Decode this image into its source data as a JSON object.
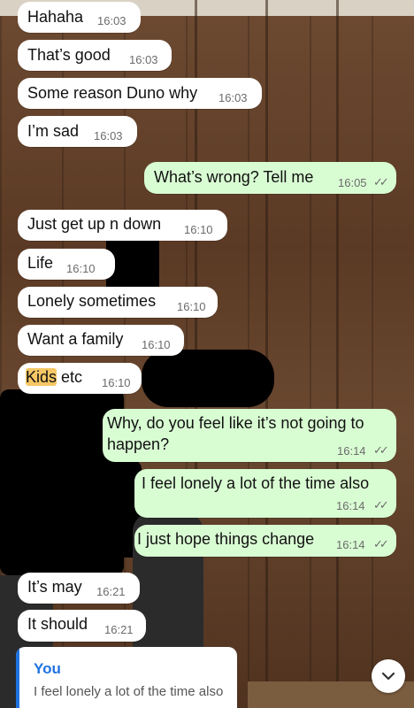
{
  "messages": [
    {
      "dir": "in",
      "text": "Hahaha",
      "time": "16:03"
    },
    {
      "dir": "in",
      "text": "That’s good",
      "time": "16:03"
    },
    {
      "dir": "in",
      "text": "Some reason Duno why",
      "time": "16:03"
    },
    {
      "dir": "in",
      "text": "I’m sad",
      "time": "16:03"
    },
    {
      "dir": "out",
      "text": "What’s wrong? Tell me",
      "time": "16:05",
      "status": "read"
    },
    {
      "dir": "in",
      "text": "Just get up n down",
      "time": "16:10"
    },
    {
      "dir": "in",
      "text": "Life",
      "time": "16:10"
    },
    {
      "dir": "in",
      "text": "Lonely sometimes",
      "time": "16:10"
    },
    {
      "dir": "in",
      "text": "Want a family",
      "time": "16:10"
    },
    {
      "dir": "in",
      "text_highlight": "Kids",
      "text_rest": " etc",
      "time": "16:10"
    },
    {
      "dir": "out",
      "line1": "Why, do you feel like it’s not going to",
      "line2": "happen?",
      "time": "16:14",
      "status": "read"
    },
    {
      "dir": "out",
      "text": "I feel lonely a lot of the time also",
      "time": "16:14",
      "status": "read"
    },
    {
      "dir": "out",
      "text": "I just hope things change",
      "time": "16:14",
      "status": "read"
    },
    {
      "dir": "in",
      "text": "It’s may",
      "time": "16:21"
    },
    {
      "dir": "in",
      "text": "It should",
      "time": "16:21"
    }
  ],
  "reply_preview": {
    "author": "You",
    "quote": "I feel lonely a lot of the time also"
  },
  "scroll_button_icon": "chevron-down-icon",
  "read_ticks_icon": "double-check-icon",
  "colors": {
    "incoming": "#ffffff",
    "outgoing": "#d9fdd3",
    "accent": "#1f73e0",
    "highlight": "#f6c765"
  }
}
